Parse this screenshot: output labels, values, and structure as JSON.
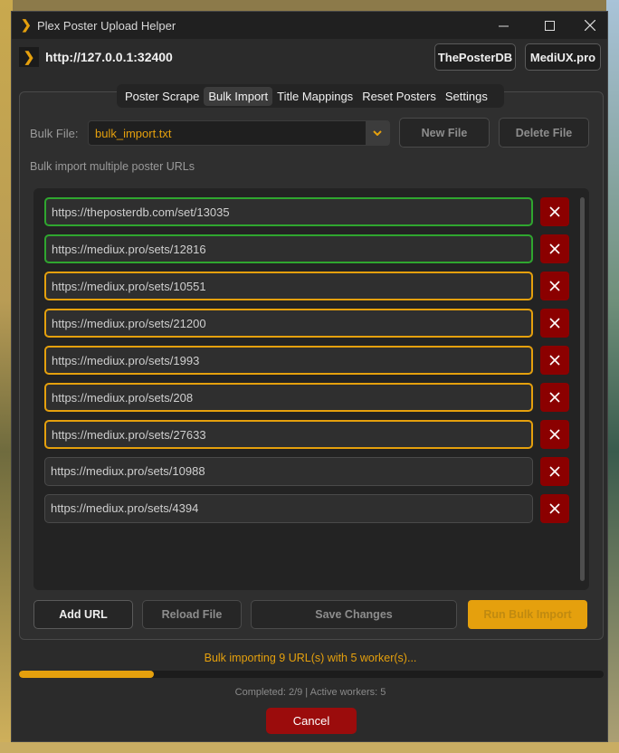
{
  "window": {
    "title": "Plex Poster Upload Helper",
    "logo_glyph": "❯"
  },
  "header": {
    "server_url": "http://127.0.0.1:32400",
    "links": [
      "ThePosterDB",
      "MediUX.pro"
    ]
  },
  "tabs": [
    {
      "label": "Poster Scrape",
      "active": false
    },
    {
      "label": "Bulk Import",
      "active": true
    },
    {
      "label": "Title Mappings",
      "active": false
    },
    {
      "label": "Reset Posters",
      "active": false
    },
    {
      "label": "Settings",
      "active": false
    }
  ],
  "bulk_file": {
    "label": "Bulk File:",
    "selected": "bulk_import.txt",
    "new_file_label": "New File",
    "delete_file_label": "Delete File"
  },
  "description": "Bulk import multiple poster URLs",
  "urls": [
    {
      "value": "https://theposterdb.com/set/13035",
      "state": "done"
    },
    {
      "value": "https://mediux.pro/sets/12816",
      "state": "done"
    },
    {
      "value": "https://mediux.pro/sets/10551",
      "state": "active"
    },
    {
      "value": "https://mediux.pro/sets/21200",
      "state": "active"
    },
    {
      "value": "https://mediux.pro/sets/1993",
      "state": "active"
    },
    {
      "value": "https://mediux.pro/sets/208",
      "state": "active"
    },
    {
      "value": "https://mediux.pro/sets/27633",
      "state": "active"
    },
    {
      "value": "https://mediux.pro/sets/10988",
      "state": "pending"
    },
    {
      "value": "https://mediux.pro/sets/4394",
      "state": "pending"
    }
  ],
  "actions": {
    "add_url": "Add URL",
    "reload_file": "Reload File",
    "save_changes": "Save Changes",
    "run_bulk_import": "Run Bulk Import"
  },
  "status": {
    "message": "Bulk importing 9 URL(s) with 5 worker(s)...",
    "progress": 0.23,
    "completed_text": "Completed: 2/9 | Active workers: 5",
    "cancel_label": "Cancel"
  },
  "colors": {
    "accent": "#e5a00d",
    "done": "#2fa62f",
    "danger": "#8b0000"
  }
}
